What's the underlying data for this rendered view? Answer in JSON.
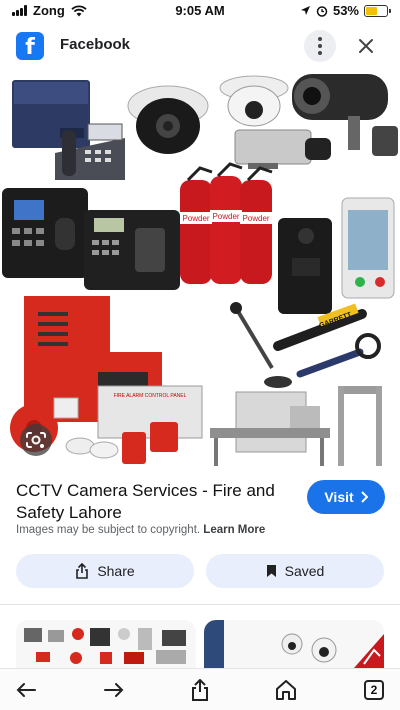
{
  "status_bar": {
    "carrier": "Zong",
    "time": "9:05 AM",
    "battery": "53%",
    "battery_level": 0.53
  },
  "header": {
    "app_icon_letter": "f",
    "title": "Facebook"
  },
  "result": {
    "title": "CCTV Camera Services - Fire and Safety Lahore",
    "visit_label": "Visit",
    "copyright_text": "Images may be subject to copyright.",
    "learn_more": "Learn More",
    "share_label": "Share",
    "saved_label": "Saved"
  },
  "image_labels": {
    "powder_1": "Powder",
    "powder_2": "Powder",
    "powder_3": "Powder",
    "garrett": "GARRETT",
    "fire_alarm_panel": "FIRE ALARM CONTROL PANEL"
  },
  "toolbar": {
    "tab_count": "2"
  },
  "colors": {
    "facebook_blue": "#1877f2",
    "visit_blue": "#1a73e8",
    "pill_bg": "#e8eefb",
    "battery_yellow": "#f2c200"
  },
  "icons": [
    "wifi-icon",
    "location-icon",
    "alarm-icon",
    "more-vert-icon",
    "close-icon",
    "google-lens-icon",
    "chevron-right-icon",
    "share-icon",
    "bookmark-icon",
    "back-arrow-icon",
    "forward-arrow-icon",
    "home-icon",
    "tabs-icon"
  ]
}
